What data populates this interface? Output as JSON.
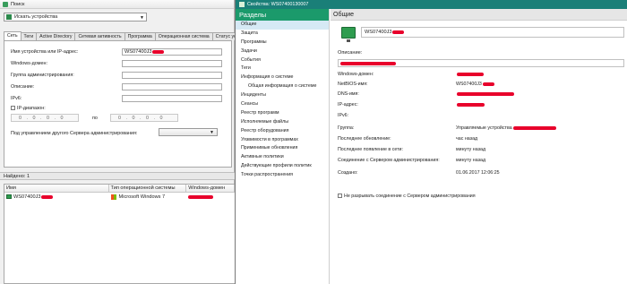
{
  "search_window": {
    "title": "Поиск",
    "search_type": "Искать устройства",
    "tabs": [
      {
        "label": "Сеть",
        "active": true
      },
      {
        "label": "Теги",
        "active": false
      },
      {
        "label": "Active Directory",
        "active": false
      },
      {
        "label": "Сетевая активность",
        "active": false
      },
      {
        "label": "Программа",
        "active": false
      },
      {
        "label": "Операционная система",
        "active": false
      },
      {
        "label": "Статус устр",
        "active": false
      }
    ],
    "fields": {
      "device_name_label": "Имя устройства или IP-адрес:",
      "device_name_value": "WS07400J3",
      "windows_domain_label": "Windows-домен:",
      "admin_group_label": "Группа администрирования:",
      "description_label": "Описание:",
      "ipv6_label": "IPv6:",
      "ip_range_label": "IP-диапазон:",
      "ip_from": "0 . 0 . 0 . 0",
      "ip_to_label": "по",
      "ip_to": "0 . 0 . 0 . 0",
      "server_label": "Под управлением другого Сервера администрирования:"
    },
    "found_label": "Найдено: 1",
    "results": {
      "columns": [
        "Имя",
        "Тип операционной системы",
        "Windows-домен"
      ],
      "rows": [
        {
          "name": "WS07400J3",
          "os": "Microsoft Windows 7",
          "domain": ""
        }
      ]
    }
  },
  "props_window": {
    "title": "Свойства: WS07400130007",
    "sidebar_header": "Разделы",
    "sidebar_items": [
      {
        "label": "Общие",
        "sub": false,
        "active": true
      },
      {
        "label": "Защита",
        "sub": false,
        "active": false
      },
      {
        "label": "Программы",
        "sub": false,
        "active": false
      },
      {
        "label": "Задачи",
        "sub": false,
        "active": false
      },
      {
        "label": "События",
        "sub": false,
        "active": false
      },
      {
        "label": "Теги",
        "sub": false,
        "active": false
      },
      {
        "label": "Информация о системе",
        "sub": false,
        "active": false
      },
      {
        "label": "Общая информация о системе",
        "sub": true,
        "active": false
      },
      {
        "label": "Инциденты",
        "sub": false,
        "active": false
      },
      {
        "label": "Сеансы",
        "sub": false,
        "active": false
      },
      {
        "label": "Реестр программ",
        "sub": false,
        "active": false
      },
      {
        "label": "Исполняемые файлы",
        "sub": false,
        "active": false
      },
      {
        "label": "Реестр оборудования",
        "sub": false,
        "active": false
      },
      {
        "label": "Уязвимости в программах",
        "sub": false,
        "active": false
      },
      {
        "label": "Применимые обновления",
        "sub": false,
        "active": false
      },
      {
        "label": "Активные политики",
        "sub": false,
        "active": false
      },
      {
        "label": "Действующие профили политик",
        "sub": false,
        "active": false
      },
      {
        "label": "Точки распространения",
        "sub": false,
        "active": false
      }
    ],
    "main_header": "Общие",
    "device_name": "WS07400J3",
    "description_label": "Описание:",
    "properties": [
      {
        "label": "Windows-домен:",
        "value": ""
      },
      {
        "label": "NetBIOS-имя:",
        "value": "WS07400J3"
      },
      {
        "label": "DNS-имя:",
        "value": ""
      },
      {
        "label": "IP-адрес:",
        "value": ""
      },
      {
        "label": "IPv6:",
        "value": ""
      },
      {
        "label": "Группа:",
        "value": "Управляемые устройства"
      },
      {
        "label": "Последнее обновление:",
        "value": "час назад"
      },
      {
        "label": "Последнее появление в сети:",
        "value": "минуту назад"
      },
      {
        "label": "Соединение с Сервером администрирования:",
        "value": "минуту назад"
      },
      {
        "label": "Создано:",
        "value": "01.06.2017 12:06:25"
      }
    ],
    "keep_connection_label": "Не разрывать соединение с Сервером администрирования"
  },
  "colors": {
    "accent": "#1b9a6b",
    "title_bar": "#1a7f78",
    "redaction": "#e8002b"
  }
}
